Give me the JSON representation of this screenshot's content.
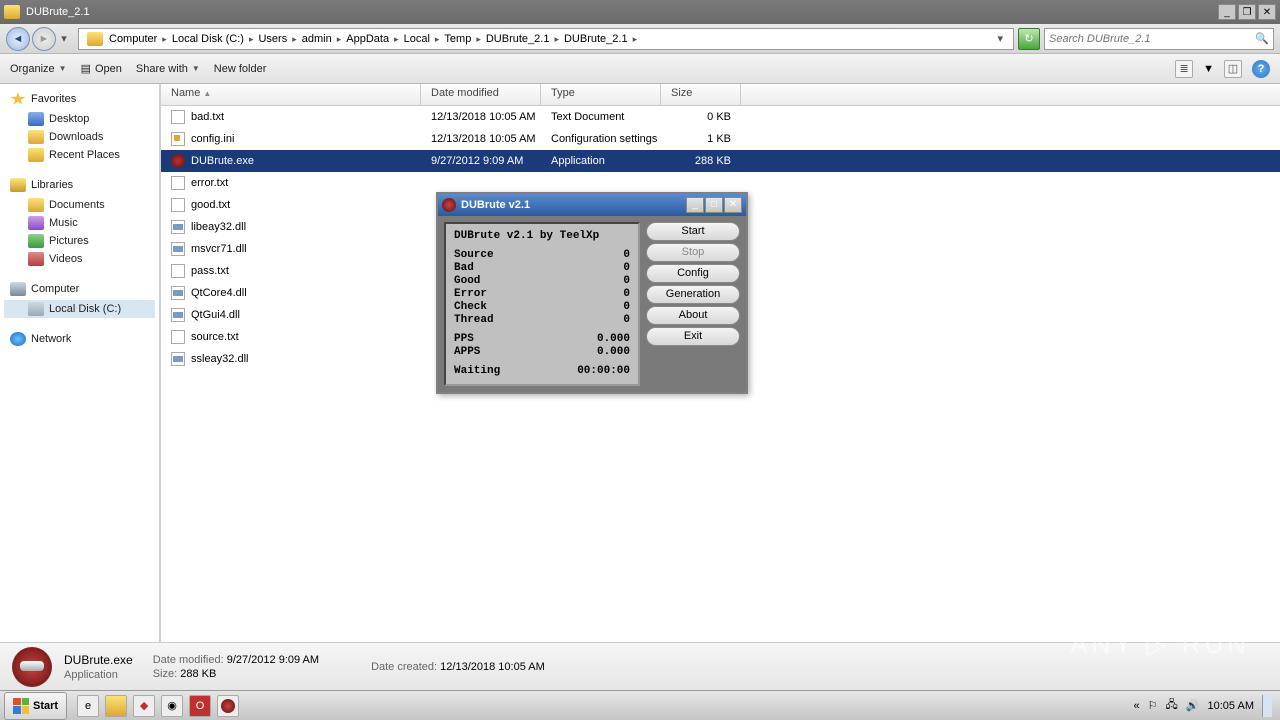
{
  "window": {
    "title": "DUBrute_2.1",
    "min": "_",
    "max": "❐",
    "close": "✕"
  },
  "nav": {
    "back_arrow": "◄",
    "fwd_arrow": "►",
    "crumbs": [
      "Computer",
      "Local Disk (C:)",
      "Users",
      "admin",
      "AppData",
      "Local",
      "Temp",
      "DUBrute_2.1",
      "DUBrute_2.1"
    ],
    "refresh": "↻",
    "search_placeholder": "Search DUBrute_2.1"
  },
  "toolbar": {
    "organize": "Organize",
    "open": "Open",
    "share": "Share with",
    "newfolder": "New folder"
  },
  "sidebar": {
    "favorites": {
      "head": "Favorites",
      "items": [
        "Desktop",
        "Downloads",
        "Recent Places"
      ]
    },
    "libraries": {
      "head": "Libraries",
      "items": [
        "Documents",
        "Music",
        "Pictures",
        "Videos"
      ]
    },
    "computer": {
      "head": "Computer",
      "items": [
        "Local Disk (C:)"
      ]
    },
    "network": {
      "head": "Network"
    }
  },
  "columns": {
    "name": "Name",
    "date": "Date modified",
    "type": "Type",
    "size": "Size"
  },
  "files": [
    {
      "name": "bad.txt",
      "date": "12/13/2018 10:05 AM",
      "type": "Text Document",
      "size": "0 KB",
      "ic": "txt"
    },
    {
      "name": "config.ini",
      "date": "12/13/2018 10:05 AM",
      "type": "Configuration settings",
      "size": "1 KB",
      "ic": "ini"
    },
    {
      "name": "DUBrute.exe",
      "date": "9/27/2012 9:09 AM",
      "type": "Application",
      "size": "288 KB",
      "ic": "exe",
      "sel": true
    },
    {
      "name": "error.txt",
      "date": "",
      "type": "",
      "size": "",
      "ic": "txt"
    },
    {
      "name": "good.txt",
      "date": "",
      "type": "",
      "size": "",
      "ic": "txt"
    },
    {
      "name": "libeay32.dll",
      "date": "",
      "type": "",
      "size": "",
      "ic": "dll"
    },
    {
      "name": "msvcr71.dll",
      "date": "",
      "type": "",
      "size": "",
      "ic": "dll"
    },
    {
      "name": "pass.txt",
      "date": "",
      "type": "",
      "size": "",
      "ic": "txt"
    },
    {
      "name": "QtCore4.dll",
      "date": "",
      "type": "",
      "size": "",
      "ic": "dll"
    },
    {
      "name": "QtGui4.dll",
      "date": "",
      "type": "",
      "size": "",
      "ic": "dll"
    },
    {
      "name": "source.txt",
      "date": "",
      "type": "",
      "size": "",
      "ic": "txt"
    },
    {
      "name": "ssleay32.dll",
      "date": "",
      "type": "",
      "size": "",
      "ic": "dll"
    }
  ],
  "details": {
    "name": "DUBrute.exe",
    "type": "Application",
    "mod_label": "Date modified:",
    "mod": "9/27/2012 9:09 AM",
    "created_label": "Date created:",
    "created": "12/13/2018 10:05 AM",
    "size_label": "Size:",
    "size": "288 KB"
  },
  "taskbar": {
    "start": "Start",
    "clock": "10:05 AM"
  },
  "app": {
    "title": "DUBrute v2.1",
    "head": "DUBrute v2.1 by TeelXp",
    "stats": {
      "Source": "0",
      "Bad": "0",
      "Good": "0",
      "Error": "0",
      "Check": "0",
      "Thread": "0",
      "PPS": "0.000",
      "APPS": "0.000"
    },
    "waiting_label": "Waiting",
    "waiting": "00:00:00",
    "buttons": {
      "start": "Start",
      "stop": "Stop",
      "config": "Config",
      "gen": "Generation",
      "about": "About",
      "exit": "Exit"
    }
  },
  "watermark": "ANY ▷ RUN"
}
